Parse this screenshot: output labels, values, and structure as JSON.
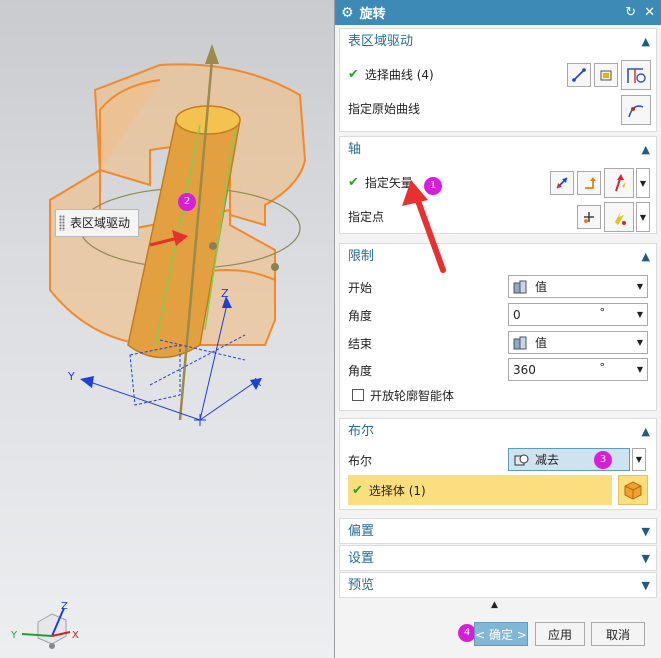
{
  "viewport": {
    "floating_label": "表区域驱动",
    "badges": [
      "2"
    ],
    "triad_axis_labels": {
      "z": "Z",
      "y": "Y",
      "x": "X"
    },
    "corner_axis_labels": {
      "z": "Z",
      "y": "Y",
      "x": "X"
    }
  },
  "dialog": {
    "title": "旋转",
    "sections": {
      "surface": {
        "title": "表区域驱动",
        "select_curve_label": "选择曲线 (4)",
        "specify_original_label": "指定原始曲线"
      },
      "axis": {
        "title": "轴",
        "specify_vector_label": "指定矢量",
        "specify_point_label": "指定点",
        "badge": "1"
      },
      "limits": {
        "title": "限制",
        "start_label": "开始",
        "start_value": "值",
        "start_angle_label": "角度",
        "start_angle_value": "0",
        "end_label": "结束",
        "end_value": "值",
        "end_angle_label": "角度",
        "end_angle_value": "360",
        "unit": "°",
        "open_profile_label": "开放轮廓智能体"
      },
      "boolean": {
        "title": "布尔",
        "bool_label": "布尔",
        "bool_value": "减去",
        "badge": "3",
        "select_body_label": "选择体 (1)"
      },
      "offset": {
        "title": "偏置"
      },
      "settings": {
        "title": "设置"
      },
      "preview": {
        "title": "预览"
      }
    },
    "footer": {
      "badge": "4",
      "ok_label": "< 确定 >",
      "apply_label": "应用",
      "cancel_label": "取消"
    }
  },
  "colors": {
    "title_bar": "#3d8ab6",
    "section_title": "#2a6b93",
    "check": "#27a127",
    "badge": "#d81fd8",
    "selection_highlight": "#fbdf7f",
    "solid_orange": "#e3a040"
  }
}
